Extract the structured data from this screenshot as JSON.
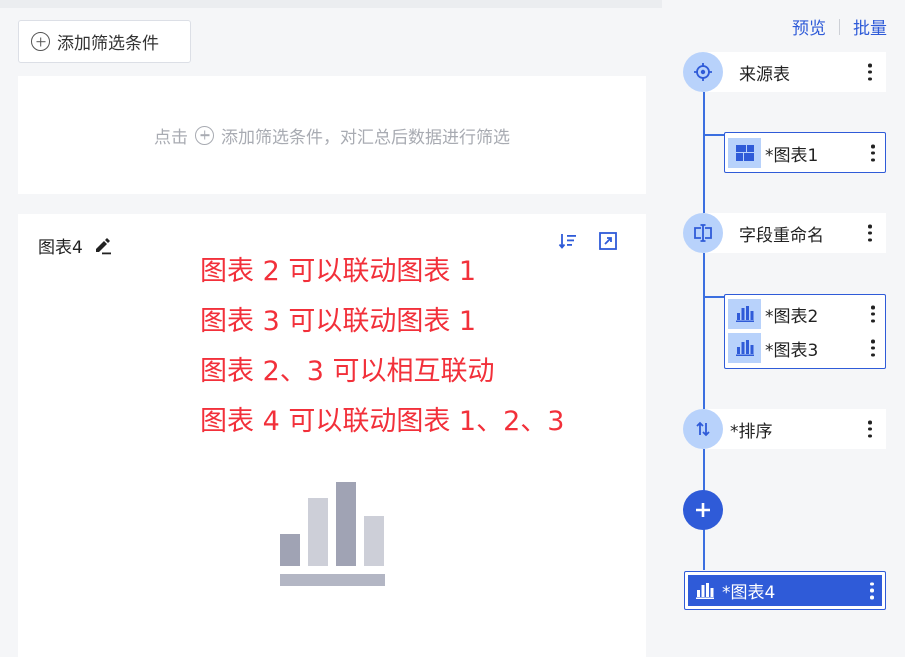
{
  "toolbar": {
    "add_filter_label": "添加筛选条件"
  },
  "filter_area": {
    "hint_prefix": "点击",
    "hint_suffix": "添加筛选条件，对汇总后数据进行筛选"
  },
  "chart_panel": {
    "title": "图表4",
    "notes": [
      "图表 2 可以联动图表 1",
      "图表 3 可以联动图表 1",
      "图表 2、3 可以相互联动",
      "图表 4 可以联动图表 1、2、3"
    ]
  },
  "right_panel": {
    "links": {
      "preview": "预览",
      "batch": "批量"
    },
    "steps": {
      "source": "来源表",
      "rename": "字段重命名",
      "sort": "*排序"
    },
    "groups": {
      "group1": [
        "*图表1"
      ],
      "group2": [
        "*图表2",
        "*图表3"
      ],
      "selected": "*图表4"
    }
  },
  "colors": {
    "accent": "#2f5bd8",
    "light_accent": "#b8d2fb",
    "note_red": "#f2303a"
  }
}
